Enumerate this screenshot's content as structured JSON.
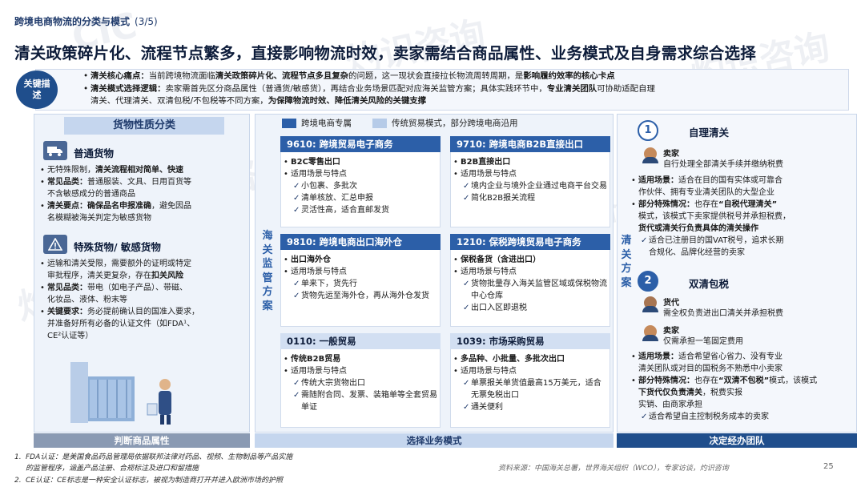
{
  "page": {
    "section_title": "跨境电商物流的分类与模式",
    "page_indicator": "(3/5)",
    "headline": "清关政策碎片化、流程节点繁多，直接影响物流时效，卖家需结合商品属性、业务模式及自身需求综合选择",
    "page_number": "25",
    "source": "资料来源：中国海关总署，世界海关组织（WCO），专家访谈，灼识咨询"
  },
  "watermark": {
    "brand": "CIC",
    "cn": "灼识咨询",
    "en": "China Insights Consultancy"
  },
  "description": {
    "badge": "关键描述",
    "line1_label": "清关核心痛点：",
    "line1_text": "当前跨境物流面临",
    "line1_bold": "清关政策碎片化、流程节点多且复杂",
    "line1_text2": "的问题，这一现状会直接拉长物流周转周期，是",
    "line1_bold2": "影响履约效率的核心卡点",
    "line2_label": "清关模式选择逻辑：",
    "line2_text": "卖家需首先区分商品属性（普通货/敏感货），再结合业务场景匹配对应海关监管方案；具体实践环节中，",
    "line2_bold": "专业清关团队",
    "line2_text2": "可协助适配自理",
    "line3_text": "清关、代理清关、双清包税/不包税等不同方案，",
    "line3_bold": "为保障物流时效、降低清关风险的关键支撑"
  },
  "left": {
    "header": "货物性质分类",
    "footer": "判断商品属性",
    "normal": {
      "title": "普通货物",
      "l1": "无特殊限制，",
      "l1b": "清关流程相对简单、快速",
      "l2_label": "常见品类：",
      "l2": "普通服装、文具、日用百货等",
      "l2c": "不含敏感成分的普通商品",
      "l3_label": "清关要点：",
      "l3_bold": "确保品名申报准确",
      "l3": "，避免因品",
      "l3c": "名模糊被海关判定为敏感货物"
    },
    "special": {
      "title": "特殊货物/ 敏感货物",
      "l1": "运输和清关受限，需要额外的证明或特定",
      "l1c": "审批程序，清关更复杂，存在",
      "l1b": "扣关风险",
      "l2_label": "常见品类：",
      "l2": "带电（如电子产品）、带磁、",
      "l2c": "化妆品、液体、粉末等",
      "l3_label": "关键要求：",
      "l3": "务必提前确认目的国准入要求，",
      "l3c": "并准备好所有必备的认证文件（如FDA¹、",
      "l3d": "CE²认证等）"
    }
  },
  "middle": {
    "legend_a": "跨境电商专属",
    "legend_b": "传统贸易模式，部分跨境电商沿用",
    "vertical_label": "海关监管方案",
    "footer": "选择业务模式",
    "scenario_label": "适用场景与特点",
    "cards": [
      {
        "code": "9610: 跨境贸易电子商务",
        "sub": "B2C零售出口",
        "points": [
          "小包裹、多批次",
          "清单核放、汇总申报",
          "灵活性高，适合直邮发货"
        ]
      },
      {
        "code": "9710: 跨境电商B2B直接出口",
        "sub": "B2B直接出口",
        "points": [
          "境内企业与境外企业通过电商平台交易",
          "简化B2B报关流程"
        ]
      },
      {
        "code": "9810: 跨境电商出口海外仓",
        "sub": "出口海外仓",
        "points": [
          "单来下，货先行",
          "货物先运至海外仓，再从海外仓发货"
        ]
      },
      {
        "code": "1210: 保税跨境贸易电子商务",
        "sub": "保税备货（含进出口）",
        "points": [
          "货物批量存入海关监管区域或保税物流中心仓库",
          "出口入区即退税"
        ]
      },
      {
        "code": "0110: 一般贸易",
        "sub": "传统B2B贸易",
        "points": [
          "传统大宗货物出口",
          "需随附合同、发票、装箱单等全套贸易单证"
        ]
      },
      {
        "code": "1039: 市场采购贸易",
        "sub": "多品种、小批量、多批次出口",
        "points": [
          "单票报关单货值最高15万美元，适合无票免税出口",
          "通关便利"
        ]
      }
    ]
  },
  "right": {
    "vertical_label": "清关方案",
    "footer": "决定经办团队",
    "self": {
      "num": "1",
      "title": "自理清关",
      "role": "卖家",
      "role_text": "自行处理全部清关手续并缴纳税费",
      "scene_label": "适用场景：",
      "scene": "适合在目的国有实体或可靠合",
      "scene_c": "作伙伴、拥有专业清关团队的大型企业",
      "special_label": "部分特殊情况：",
      "special_a": "也存在",
      "special_bold": "“自税代理清关”",
      "special_c": "模式，该模式下卖家提供税号并承担税费，",
      "special_d": "货代或清关行负责具体的清关操作",
      "check": "适合已注册目的国VAT税号，追求长期",
      "check_c": "合规化、品牌化经营的卖家"
    },
    "double": {
      "num": "2",
      "title": "双清包税",
      "role_a": "货代",
      "role_a_text": "需全权负责进出口清关并承担税费",
      "role_b": "卖家",
      "role_b_text": "仅需承担一笔固定费用",
      "scene_label": "适用场景：",
      "scene": "适合希望省心省力、没有专业",
      "scene_c": "清关团队或对目的国税务不熟悉中小卖家",
      "special_label": "部分特殊情况：",
      "special_a": "也存在",
      "special_bold": "“双清不包税”",
      "special_c": "模式，该模式",
      "special_bold2": "下货代仅负责清关",
      "special_d": "，税费实报",
      "special_e": "实销、由商家承担",
      "check": "适合希望自主控制税务成本的卖家"
    }
  },
  "footnotes": {
    "n1": "1.",
    "f1": "FDA认证：是美国食品药品管理局依据联邦法律对药品、视频、生物制品等产品实施",
    "f1c": "的监管程序，涵盖产品注册、合规标注及进口和留措施",
    "n2": "2.",
    "f2": "CE认证：CE标志是一种安全认证标志，被视为制造商打开并进入欧洲市场的护照"
  },
  "colors": {
    "navy": "#1f4e8c",
    "accent": "#2c5fa8",
    "panel": "#eef3fa",
    "header_light": "#c5d6ee"
  }
}
